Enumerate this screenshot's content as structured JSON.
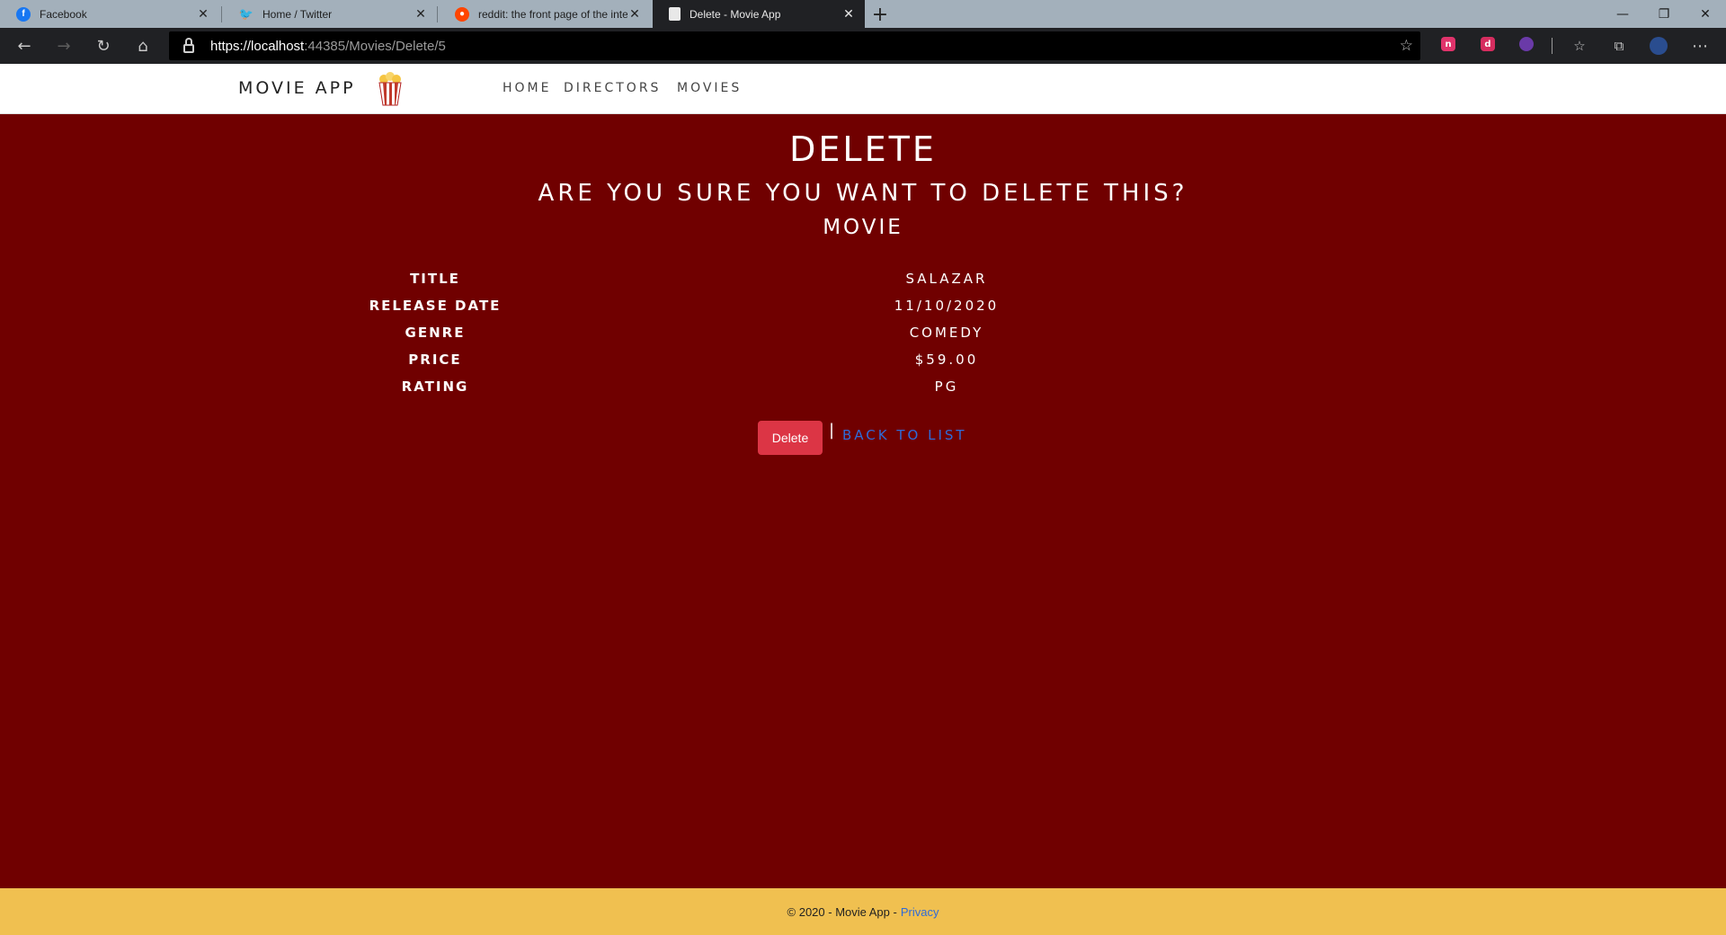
{
  "browser": {
    "tabs": [
      {
        "title": "Facebook",
        "icon": "facebook-icon",
        "color": "#1877f2"
      },
      {
        "title": "Home / Twitter",
        "icon": "twitter-icon",
        "color": "#1da1f2"
      },
      {
        "title": "reddit: the front page of the inte",
        "icon": "reddit-icon",
        "color": "#ff4500"
      },
      {
        "title": "Delete - Movie App",
        "icon": "page-icon",
        "color": "#e8e8e8"
      }
    ],
    "url_host": "https://localhost",
    "url_rest": ":44385/Movies/Delete/5"
  },
  "site": {
    "brand": "MOVIE APP",
    "nav": [
      "HOME",
      "DIRECTORS",
      "MOVIES"
    ]
  },
  "page": {
    "title": "DELETE",
    "question": "ARE YOU SURE YOU WANT TO DELETE THIS?",
    "entity": "MOVIE",
    "fields": [
      {
        "label": "TITLE",
        "value": "SALAZAR"
      },
      {
        "label": "RELEASE DATE",
        "value": "11/10/2020"
      },
      {
        "label": "GENRE",
        "value": "COMEDY"
      },
      {
        "label": "PRICE",
        "value": "$59.00"
      },
      {
        "label": "RATING",
        "value": "PG"
      }
    ],
    "delete_label": "Delete",
    "separator": "|",
    "back_label": "BACK TO LIST"
  },
  "footer": {
    "text": "© 2020 - Movie App -",
    "privacy": "Privacy"
  },
  "colors": {
    "page_bg": "#700000",
    "footer_bg": "#f0c050",
    "danger": "#dc3545",
    "link": "#2f6bd8"
  }
}
